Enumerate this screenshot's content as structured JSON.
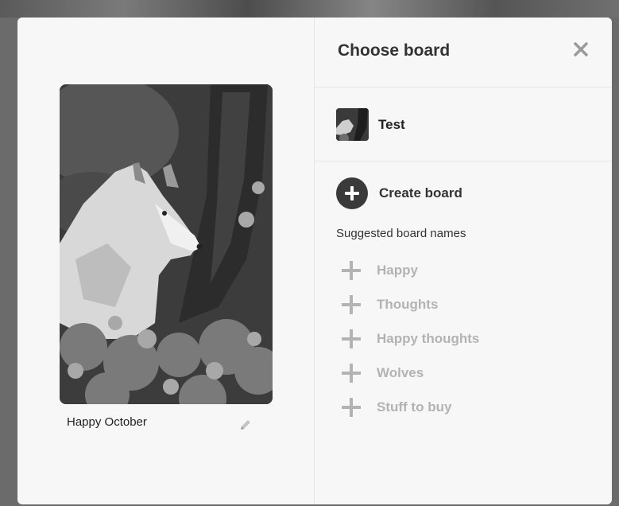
{
  "pin": {
    "caption": "Happy October"
  },
  "dialog": {
    "title": "Choose board"
  },
  "boards": [
    {
      "name": "Test"
    }
  ],
  "create": {
    "label": "Create board"
  },
  "suggestions": {
    "heading": "Suggested board names",
    "items": [
      "Happy",
      "Thoughts",
      "Happy thoughts",
      "Wolves",
      "Stuff to buy"
    ]
  },
  "icons": {
    "close": "close-icon",
    "edit": "pencil-icon",
    "create": "plus-circle-icon",
    "suggest": "plus-icon"
  },
  "colors": {
    "modal_bg": "#f7f7f7",
    "create_icon": "#3a3a3a",
    "suggestion_text": "#b3b3b3"
  }
}
